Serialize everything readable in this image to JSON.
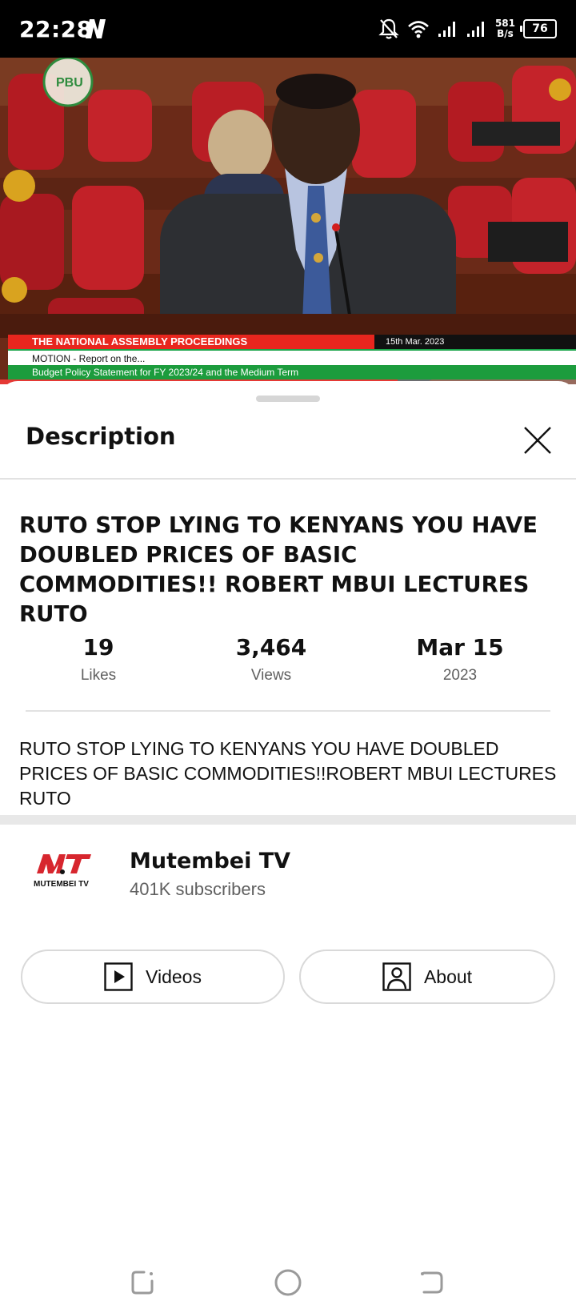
{
  "status_bar": {
    "time": "22:28",
    "net_speed_value": "581",
    "net_speed_unit": "B/s",
    "battery": "76"
  },
  "video": {
    "ticker_top": "THE NATIONAL ASSEMBLY PROCEEDINGS",
    "ticker_date": "15th Mar. 2023",
    "ticker_motion": "MOTION - Report on the...",
    "ticker_bottom": "Budget Policy Statement for FY 2023/24 and the Medium Term",
    "channel_watermark": "PBU",
    "progress": 0.69
  },
  "sheet": {
    "title": "Description",
    "video_title": "RUTO STOP LYING TO KENYANS YOU HAVE DOUBLED PRICES OF BASIC COMMODITIES!! ROBERT MBUI LECTURES RUTO",
    "stats": [
      {
        "value": "19",
        "label": "Likes"
      },
      {
        "value": "3,464",
        "label": "Views"
      },
      {
        "value": "Mar 15",
        "label": "2023"
      }
    ],
    "description": "RUTO STOP LYING TO KENYANS YOU HAVE DOUBLED PRICES OF BASIC COMMODITIES!!ROBERT MBUI LECTURES RUTO"
  },
  "channel": {
    "name": "Mutembei TV",
    "subscribers": "401K subscribers",
    "logo_text": "MUTEMBEI TV",
    "videos_label": "Videos",
    "about_label": "About"
  },
  "colors": {
    "accent_red": "#e53935",
    "ticker_green": "#1c9c3d",
    "text_primary": "#111111",
    "text_secondary": "#606060"
  }
}
